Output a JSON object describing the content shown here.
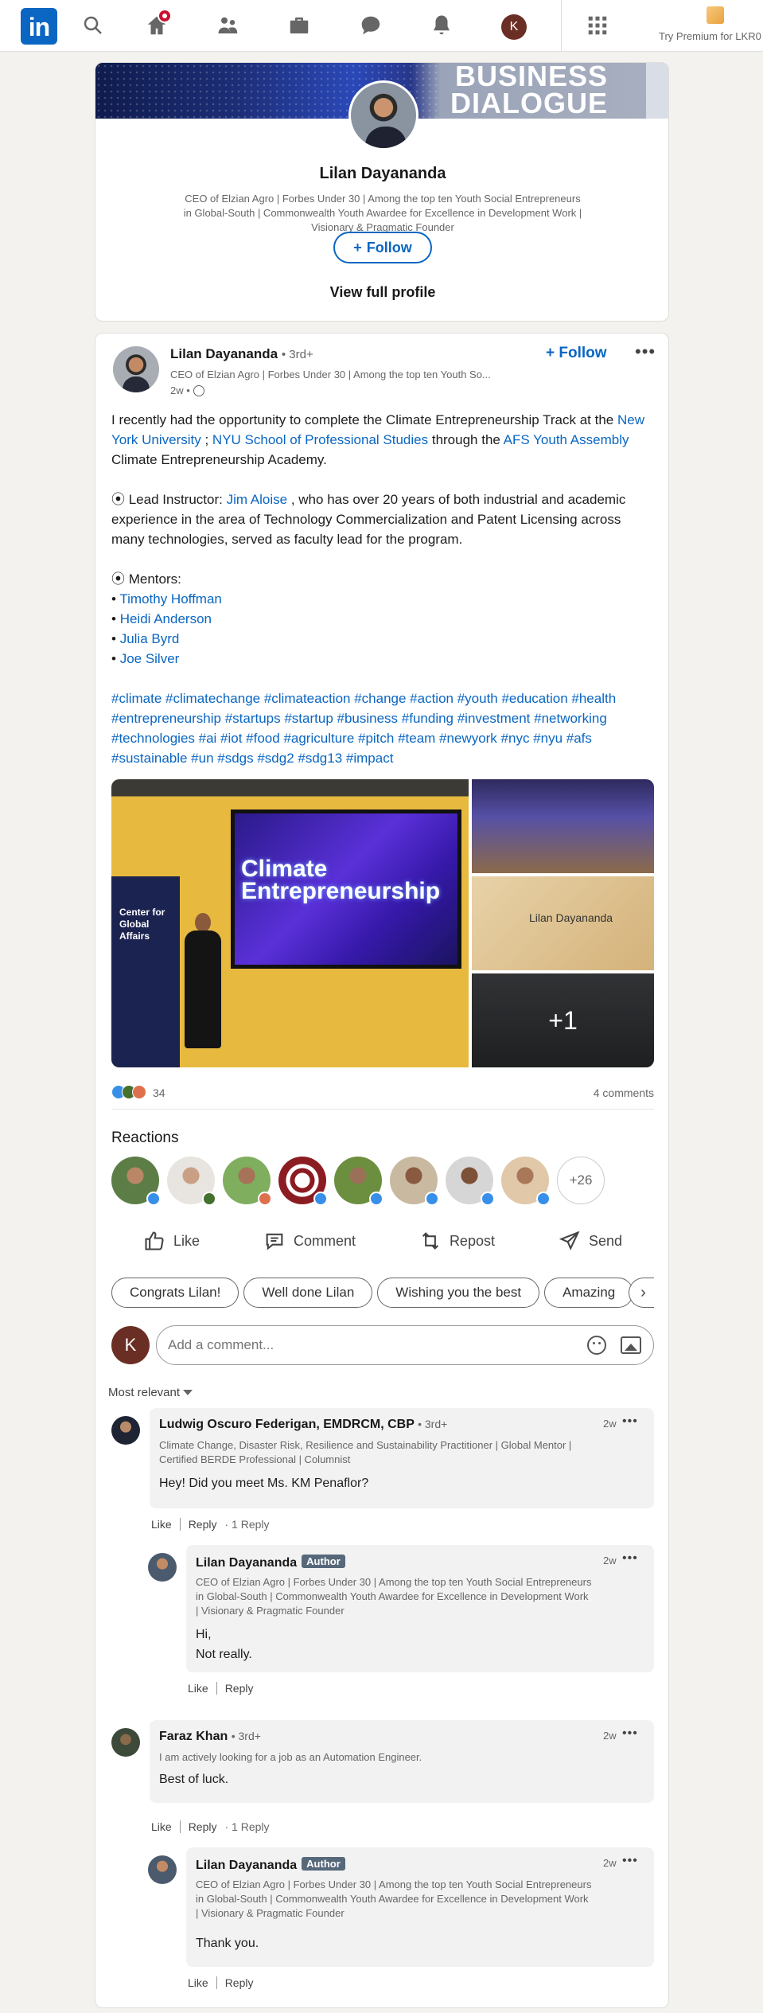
{
  "nav": {
    "logo": "in",
    "me_initial": "K",
    "premium_label": "Try Premium for LKR0"
  },
  "profile_card": {
    "banner_text_line1": "BUSINESS",
    "banner_text_line2": "DIALOGUE",
    "name": "Lilan Dayananda",
    "headline": "CEO of Elzian Agro | Forbes Under 30 | Among the top ten Youth Social Entrepreneurs in Global-South | Commonwealth Youth Awardee for Excellence in Development Work | Visionary & Pragmatic Founder",
    "follow_label": "Follow",
    "view_profile_label": "View full profile"
  },
  "post": {
    "author_name": "Lilan Dayananda",
    "author_degree": "• 3rd+",
    "author_headline": "CEO of Elzian Agro | Forbes Under 30 | Among the top ten Youth So...",
    "time": "2w •",
    "follow_label": "Follow",
    "body": {
      "p1_a": "I recently had the opportunity to complete the Climate Entrepreneurship Track at the ",
      "link_nyu": "New York University",
      "p1_sep": " ; ",
      "link_nyu_sps": "NYU School of Professional Studies",
      "p1_b": " through the ",
      "link_afs": "AFS Youth Assembly",
      "p1_c": " Climate Entrepreneurship Academy.",
      "p2_a": "⦿ Lead Instructor: ",
      "link_jim": "Jim Aloise",
      "p2_b": " , who has over 20 years of both industrial and academic experience in the area of Technology Commercialization and Patent Licensing across many technologies, served as faculty lead for the program.",
      "mentors_heading": "⦿ Mentors:",
      "mentors": [
        "Timothy Hoffman",
        "Heidi Anderson",
        "Julia Byrd",
        "Joe Silver"
      ],
      "hashtags": "#climate #climatechange #climateaction #change #action #youth #education #health #entrepreneurship #startups #startup #business #funding #investment #networking #technologies #ai #iot #food #agriculture #pitch #team #newyork #nyc #nyu #afs #sustainable #un #sdgs #sdg2 #sdg13 #impact"
    },
    "gallery": {
      "screen_text": "Climate Entrepreneurship",
      "stand_text": "Center for Global Affairs",
      "certificate_name": "Lilan Dayananda",
      "more_label": "+1"
    },
    "reaction_count": "34",
    "comments_count": "4 comments",
    "reactions_title": "Reactions",
    "more_reactors": "+26",
    "actions": {
      "like": "Like",
      "comment": "Comment",
      "repost": "Repost",
      "send": "Send"
    },
    "suggestions": [
      "Congrats Lilan!",
      "Well done Lilan",
      "Wishing you the best",
      "Amazing"
    ],
    "comment_input": {
      "avatar_initial": "K",
      "placeholder": "Add a comment..."
    },
    "sort_label": "Most relevant"
  },
  "comments": [
    {
      "name": "Ludwig Oscuro Federigan, EMDRCM, CBP",
      "degree": "• 3rd+",
      "headline": "Climate Change, Disaster Risk, Resilience and Sustainability Practitioner | Global Mentor | Certified BERDE Professional | Columnist",
      "text": "Hey! Did you meet Ms. KM Penaflor?",
      "time": "2w",
      "like": "Like",
      "reply": "Reply",
      "replies": "· 1 Reply"
    },
    {
      "name": "Lilan Dayananda",
      "badge": "Author",
      "headline": "CEO of Elzian Agro | Forbes Under 30 | Among the top ten Youth Social Entrepreneurs in Global-South | Commonwealth Youth Awardee for Excellence in Development Work | Visionary & Pragmatic Founder",
      "text_line1": "Hi,",
      "text_line2": "Not really.",
      "time": "2w",
      "like": "Like",
      "reply": "Reply"
    },
    {
      "name": "Faraz Khan",
      "degree": "• 3rd+",
      "headline": "I am actively looking for a job as an Automation Engineer.",
      "text": "Best of luck.",
      "time": "2w",
      "like": "Like",
      "reply": "Reply",
      "replies": "· 1 Reply"
    },
    {
      "name": "Lilan Dayananda",
      "badge": "Author",
      "headline": "CEO of Elzian Agro | Forbes Under 30 | Among the top ten Youth Social Entrepreneurs in Global-South | Commonwealth Youth Awardee for Excellence in Development Work | Visionary & Pragmatic Founder",
      "text": "Thank you.",
      "time": "2w",
      "like": "Like",
      "reply": "Reply"
    }
  ],
  "colors": {
    "brand": "#0a66c2",
    "background": "#f4f2ee",
    "notification": "#cb112d",
    "author_badge": "#56687a"
  }
}
